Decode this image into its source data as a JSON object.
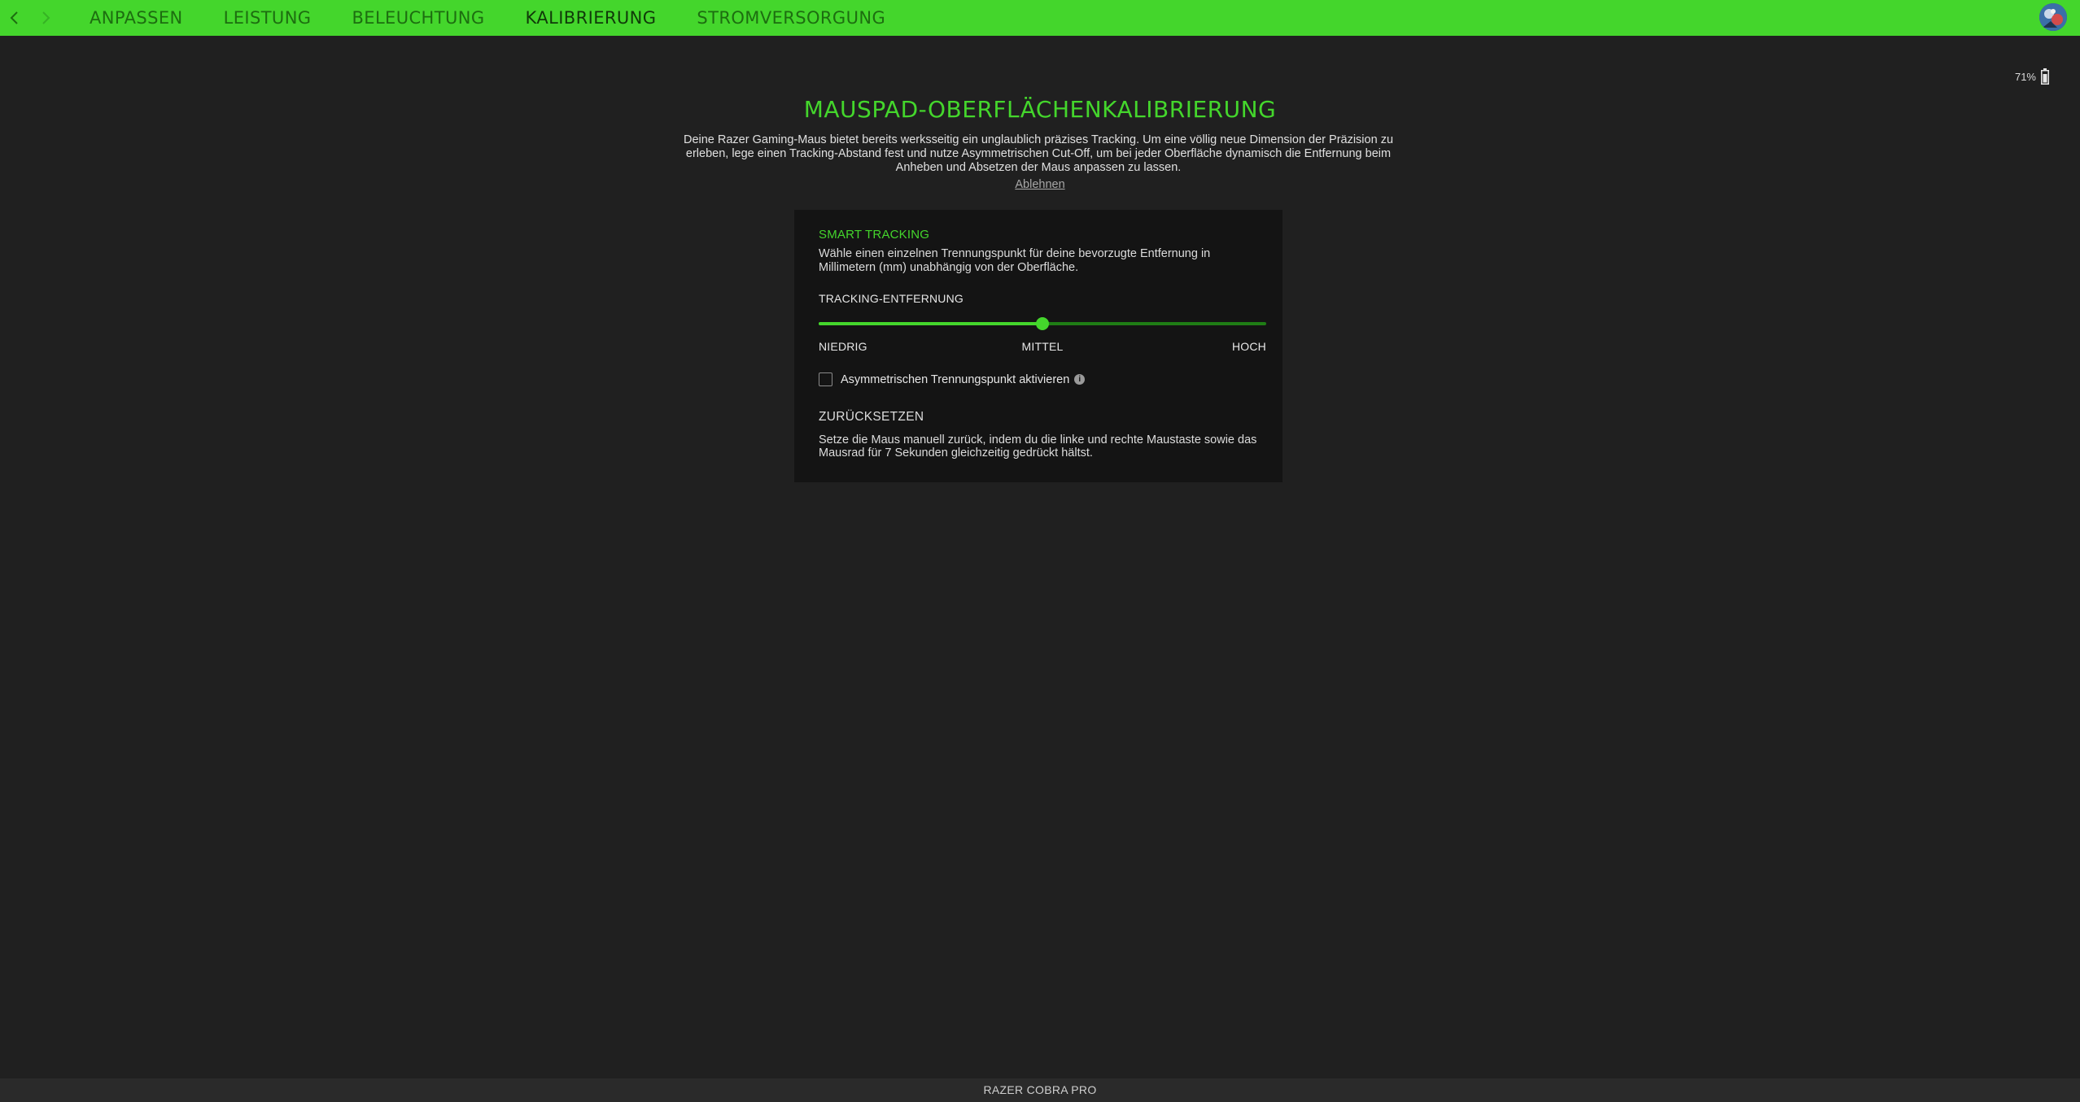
{
  "nav": {
    "tabs": [
      {
        "label": "ANPASSEN"
      },
      {
        "label": "LEISTUNG"
      },
      {
        "label": "BELEUCHTUNG"
      },
      {
        "label": "KALIBRIERUNG"
      },
      {
        "label": "STROMVERSORGUNG"
      }
    ],
    "active_tab": "KALIBRIERUNG",
    "back_icon": "chevron-left-icon",
    "forward_icon": "chevron-right-icon"
  },
  "battery": {
    "percent_text": "71%",
    "icon": "battery-icon"
  },
  "header": {
    "title": "MAUSPAD-OBERFLÄCHENKALIBRIERUNG",
    "description": "Deine Razer Gaming-Maus bietet bereits werksseitig ein unglaublich präzises Tracking. Um eine völlig neue Dimension der Präzision zu erleben, lege einen Tracking-Abstand fest und nutze Asymmetrischen Cut-Off, um bei jeder Oberfläche dynamisch die Entfernung beim Anheben und Absetzen der Maus anpassen zu lassen.",
    "decline_label": "Ablehnen"
  },
  "smart_tracking": {
    "title": "SMART TRACKING",
    "description": "Wähle einen einzelnen Trennungspunkt für deine bevorzugte Entfernung in Millimetern (mm) unabhängig von der Oberfläche.",
    "slider_label": "TRACKING-ENTFERNUNG",
    "slider_value_fraction": 0.5,
    "ticks": {
      "low": "NIEDRIG",
      "mid": "MITTEL",
      "high": "HOCH"
    },
    "asymmetric_checkbox_label": "Asymmetrischen Trennungspunkt aktivieren",
    "asymmetric_checked": false
  },
  "reset": {
    "title": "ZURÜCKSETZEN",
    "description": "Setze die Maus manuell zurück, indem du die linke und rechte Maustaste sowie das Mausrad für 7 Sekunden gleichzeitig gedrückt hältst."
  },
  "footer": {
    "device_name": "RAZER COBRA PRO"
  },
  "colors": {
    "accent": "#44d62c",
    "background": "#202020",
    "card": "#141414"
  }
}
